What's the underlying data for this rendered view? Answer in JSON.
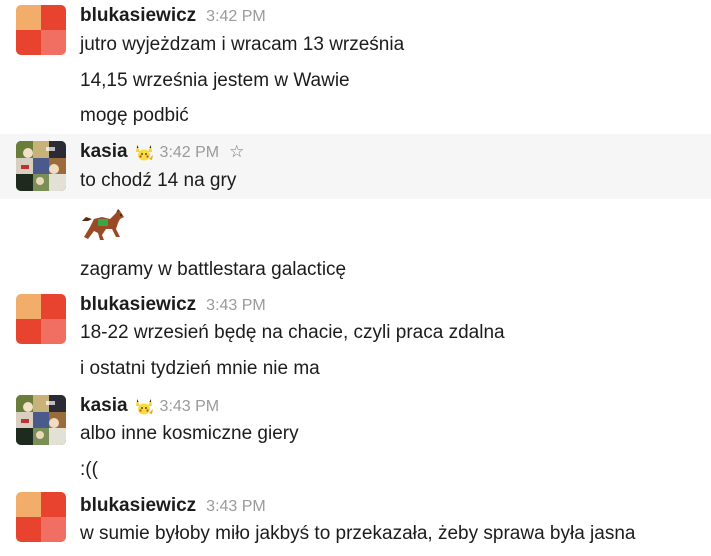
{
  "groups": [
    {
      "author": "blukasiewicz",
      "time": "3:42 PM",
      "messages": [
        "jutro wyjeżdzam i wracam 13 września",
        "14,15 września jestem w Wawie",
        "mogę podbić"
      ]
    },
    {
      "author": "kasia",
      "time": "3:42 PM",
      "status_emoji": "pikachu-emoji",
      "star": "☆",
      "messages": [
        "to chodź 14 na gry",
        "zagramy w battlestara galacticę"
      ],
      "attachment_emoji": "racehorse-emoji"
    },
    {
      "author": "blukasiewicz",
      "time": "3:43 PM",
      "messages": [
        "18-22 wrzesień będę na chacie, czyli praca zdalna",
        "i ostatni tydzień mnie nie ma"
      ]
    },
    {
      "author": "kasia",
      "time": "3:43 PM",
      "status_emoji": "pikachu-emoji",
      "messages": [
        "albo inne kosmiczne giery",
        ":(("
      ]
    },
    {
      "author": "blukasiewicz",
      "time": "3:43 PM",
      "messages": [
        "w sumie byłoby miło jakbyś to przekazała, żeby sprawa była jasna"
      ]
    }
  ],
  "colors": {
    "avatar_orange": "#f3ad6a",
    "avatar_red": "#e8432e",
    "avatar_coral": "#f16e63",
    "highlight_bg": "#f6f6f6"
  }
}
